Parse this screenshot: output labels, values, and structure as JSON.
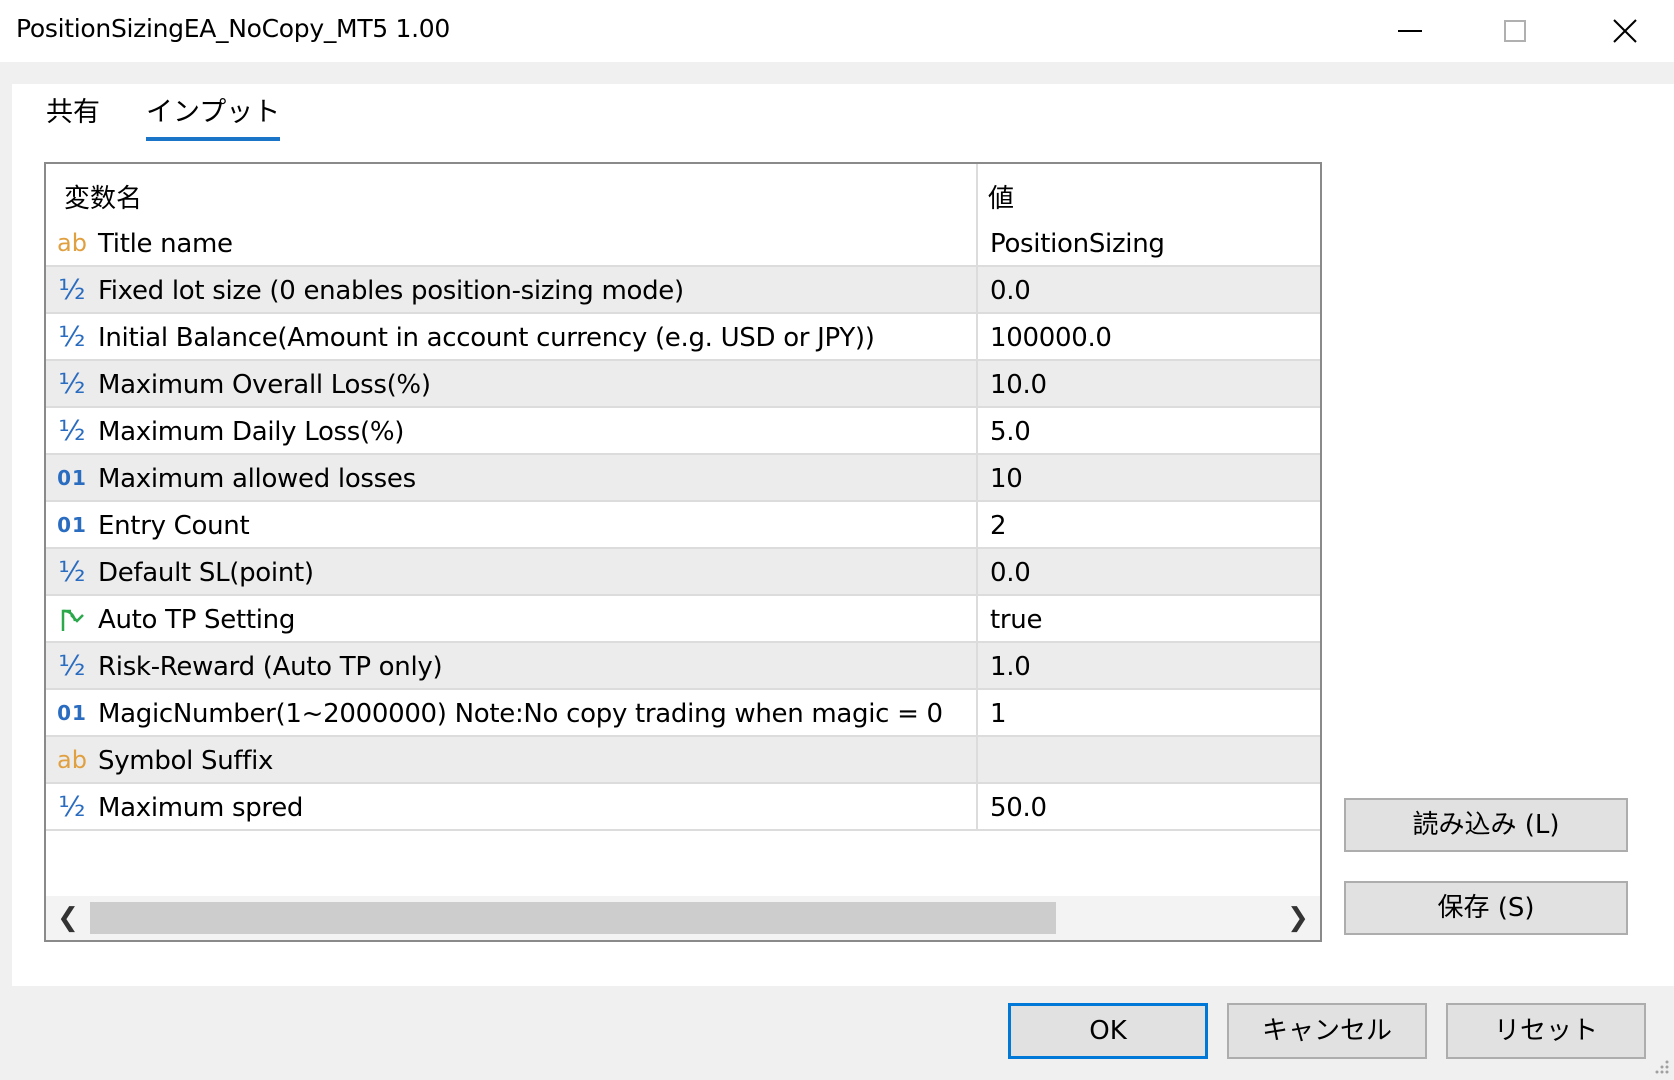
{
  "window": {
    "title": "PositionSizingEA_NoCopy_MT5 1.00"
  },
  "tabs": [
    {
      "label": "共有",
      "active": false
    },
    {
      "label": "インプット",
      "active": true
    }
  ],
  "grid": {
    "headers": {
      "name": "変数名",
      "value": "値"
    },
    "rows": [
      {
        "type": "ab",
        "name": "Title name",
        "value": "PositionSizing"
      },
      {
        "type": "half",
        "name": "Fixed lot size (0 enables position-sizing mode)",
        "value": "0.0"
      },
      {
        "type": "half",
        "name": "Initial Balance(Amount in account currency (e.g. USD or JPY))",
        "value": "100000.0"
      },
      {
        "type": "half",
        "name": "Maximum Overall Loss(%)",
        "value": "10.0"
      },
      {
        "type": "half",
        "name": "Maximum Daily Loss(%)",
        "value": "5.0"
      },
      {
        "type": "int",
        "name": "Maximum allowed losses",
        "value": "10"
      },
      {
        "type": "int",
        "name": "Entry Count",
        "value": "2"
      },
      {
        "type": "half",
        "name": "Default SL(point)",
        "value": "0.0"
      },
      {
        "type": "bool",
        "name": "Auto TP Setting",
        "value": "true"
      },
      {
        "type": "half",
        "name": "Risk-Reward (Auto TP only)",
        "value": "1.0"
      },
      {
        "type": "int",
        "name": "MagicNumber(1~2000000) Note:No copy trading when magic = 0",
        "value": "1"
      },
      {
        "type": "ab",
        "name": "Symbol Suffix",
        "value": ""
      },
      {
        "type": "half",
        "name": "Maximum spred",
        "value": "50.0"
      }
    ],
    "icon_glyphs": {
      "ab": "ab",
      "half": "½",
      "int": "01"
    }
  },
  "buttons": {
    "load": "読み込み (L)",
    "save": "保存 (S)",
    "ok": "OK",
    "cancel": "キャンセル",
    "reset": "リセット"
  },
  "colors": {
    "accent": "#0078d7",
    "tab_underline": "#1a74c8",
    "icon_string": "#e0a040",
    "icon_number": "#2a6cc0",
    "icon_bool": "#2aa84a"
  }
}
